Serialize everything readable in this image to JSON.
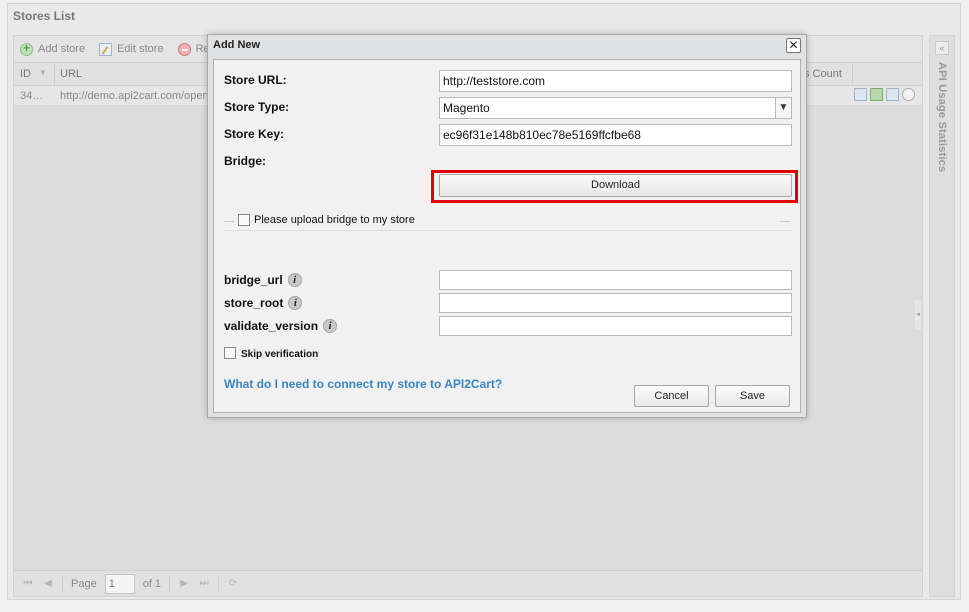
{
  "app": {
    "title": "Stores List",
    "toolbar": {
      "add_label": "Add store",
      "edit_label": "Edit store",
      "remove_label_partial": "Re"
    },
    "grid": {
      "columns": {
        "id": "ID",
        "url": "URL",
        "count_partial": "s Count"
      },
      "rows": [
        {
          "id": "34…",
          "url": "http://demo.api2cart.com/open"
        }
      ]
    },
    "pager": {
      "page_label": "Page",
      "page_value": "1",
      "of_label": "of 1"
    },
    "side_panel": {
      "title": "API Usage Statistics"
    }
  },
  "modal": {
    "title": "Add New",
    "close_glyph": "✕",
    "store_url": {
      "label": "Store URL:",
      "value": "http://teststore.com"
    },
    "store_type": {
      "label": "Store Type:",
      "value": "Magento"
    },
    "store_key": {
      "label": "Store Key:",
      "value": "ec96f31e148b810ec78e5169ffcfbe68"
    },
    "bridge": {
      "label": "Bridge:",
      "button_label": "Download"
    },
    "upload_legend": "Please upload bridge to my store",
    "bridge_url": {
      "label": "bridge_url",
      "value": ""
    },
    "store_root": {
      "label": "store_root",
      "value": ""
    },
    "validate_version": {
      "label": "validate_version",
      "value": ""
    },
    "info_glyph": "i",
    "skip_label": "Skip verification",
    "help_link": "What do I need to connect my store to API2Cart?",
    "cancel_label": "Cancel",
    "save_label": "Save"
  },
  "colors": {
    "highlight": "#e00000",
    "link": "#3a86c3"
  }
}
